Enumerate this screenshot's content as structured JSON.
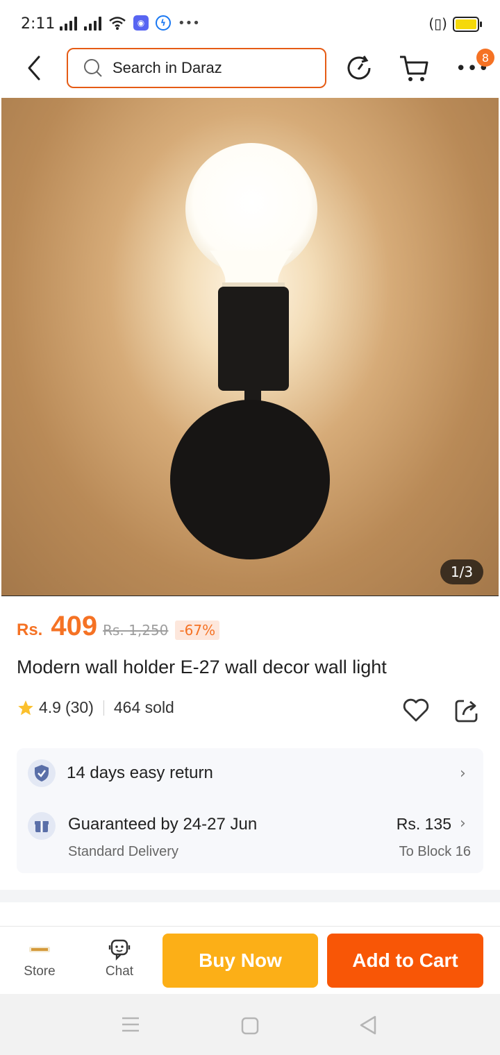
{
  "status_bar": {
    "time": "2:11"
  },
  "header": {
    "search_placeholder": "Search in Daraz",
    "cart_badge": "8"
  },
  "gallery": {
    "counter": "1/3"
  },
  "product": {
    "currency": "Rs.",
    "price": "409",
    "original_price": "Rs. 1,250",
    "discount": "-67%",
    "title": "Modern wall holder E-27 wall decor wall light",
    "rating": "4.9",
    "reviews": "(30)",
    "sold": "464 sold"
  },
  "delivery": {
    "return_text": "14 days easy return",
    "guarantee_text": "Guaranteed by 24-27 Jun",
    "delivery_type": "Standard Delivery",
    "fee": "Rs. 135",
    "destination": "To Block 16"
  },
  "bottom_bar": {
    "store_label": "Store",
    "chat_label": "Chat",
    "buy_now": "Buy Now",
    "add_to_cart": "Add to Cart"
  },
  "colors": {
    "accent": "#f57224",
    "buy_now": "#fcaf17",
    "add_to_cart": "#f85606"
  },
  "icons": [
    "back-arrow-icon",
    "search-icon",
    "history-icon",
    "cart-icon",
    "more-icon",
    "star-icon",
    "heart-icon",
    "share-icon",
    "shield-check-icon",
    "gift-icon",
    "chevron-right-icon",
    "store-icon",
    "chat-icon"
  ]
}
